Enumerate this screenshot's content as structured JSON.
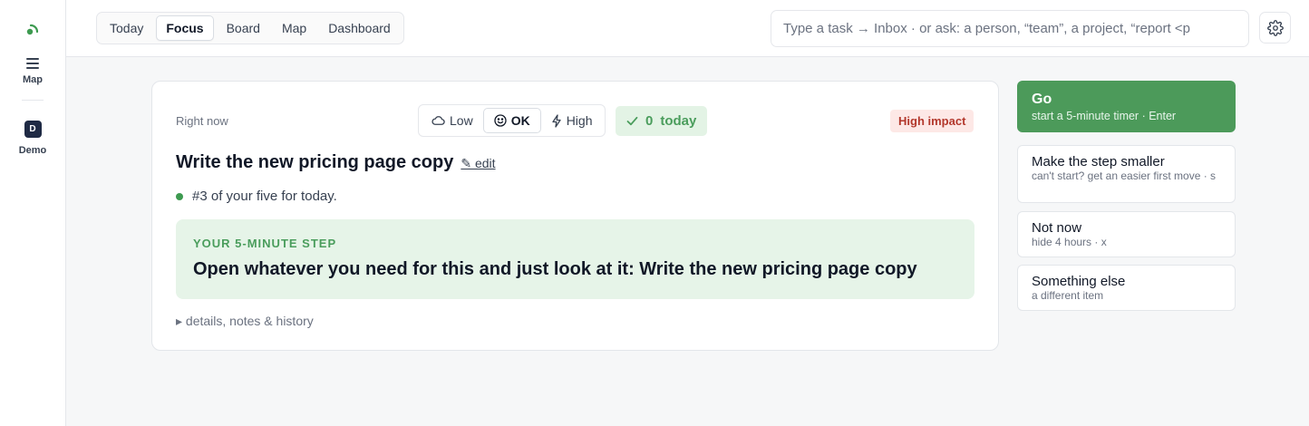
{
  "rail": {
    "map_label": "Map",
    "demo_initial": "D",
    "demo_label": "Demo"
  },
  "tabs": [
    "Today",
    "Focus",
    "Board",
    "Map",
    "Dashboard"
  ],
  "active_tab": "Focus",
  "search": {
    "placeholder": "Type a task → Inbox · or ask: a person, “team”, a project, “report <p"
  },
  "card": {
    "kicker": "Right now",
    "energy": [
      {
        "label": "Low",
        "icon": "cloud-icon"
      },
      {
        "label": "OK",
        "icon": "smile-icon",
        "selected": true
      },
      {
        "label": "High",
        "icon": "bolt-icon"
      }
    ],
    "done": {
      "count": "0",
      "label": "today"
    },
    "impact": "High impact",
    "title": "Write the new pricing page copy",
    "edit": "✎ edit",
    "bullet": "#3 of your five for today.",
    "step_kicker": "YOUR 5-MINUTE STEP",
    "step_text": "Open whatever you need for this and just look at it: Write the new pricing page copy",
    "details": "▸ details, notes & history"
  },
  "actions": {
    "go": {
      "title": "Go",
      "sub": "start a 5-minute timer · Enter"
    },
    "smaller": {
      "title": "Make the step smaller",
      "sub": "can't start? get an easier first move · s"
    },
    "notnow": {
      "title": "Not now",
      "sub": "hide 4 hours · x"
    },
    "else": {
      "title": "Something else",
      "sub": "a different item"
    }
  },
  "colors": {
    "accent_green": "#4c9a5a",
    "impact_red": "#b3382c",
    "step_bg": "#e6f4e8"
  }
}
